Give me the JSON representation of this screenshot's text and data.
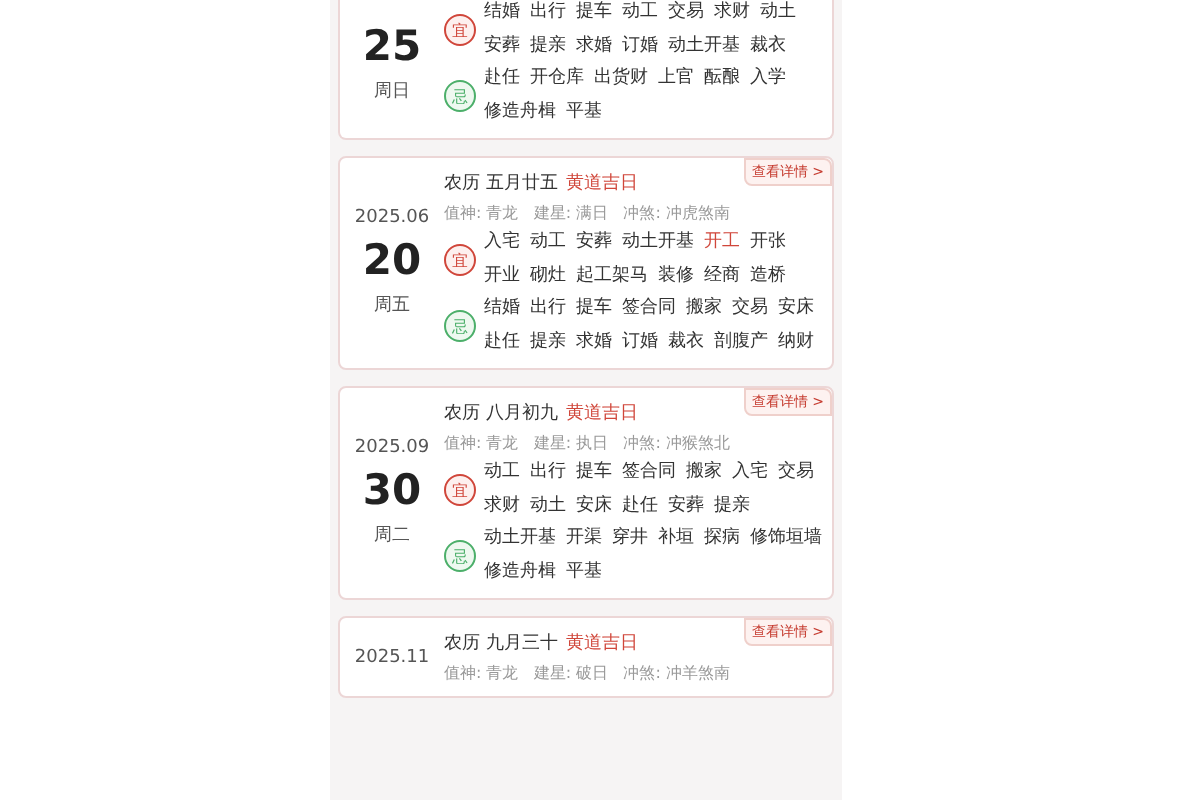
{
  "cards": [
    {
      "cut_top": true,
      "day": "25",
      "weekday": "周日",
      "yi": {
        "label": "宜",
        "items": [
          {
            "text": "结婚",
            "highlighted": false
          },
          {
            "text": "出行",
            "highlighted": false
          },
          {
            "text": "提车",
            "highlighted": false
          },
          {
            "text": "动工",
            "highlighted": false
          },
          {
            "text": "交易",
            "highlighted": false
          },
          {
            "text": "求财",
            "highlighted": false
          },
          {
            "text": "动土",
            "highlighted": false
          },
          {
            "text": "安葬",
            "highlighted": false
          },
          {
            "text": "提亲",
            "highlighted": false
          },
          {
            "text": "求婚",
            "highlighted": false
          },
          {
            "text": "订婚",
            "highlighted": false
          },
          {
            "text": "动土开基",
            "highlighted": false
          },
          {
            "text": "裁衣",
            "highlighted": false
          }
        ]
      },
      "ji": {
        "label": "忌",
        "items": [
          {
            "text": "赴任",
            "highlighted": false
          },
          {
            "text": "开仓库",
            "highlighted": false
          },
          {
            "text": "出货财",
            "highlighted": false
          },
          {
            "text": "上官",
            "highlighted": false
          },
          {
            "text": "酝酿",
            "highlighted": false
          },
          {
            "text": "入学",
            "highlighted": false
          },
          {
            "text": "修造舟楫",
            "highlighted": false
          },
          {
            "text": "平基",
            "highlighted": false
          }
        ]
      }
    },
    {
      "cut_top": false,
      "lunar": "农历 五月廿五",
      "tag": "黄道吉日",
      "link": "查看详情 >",
      "info": "值神: 青龙   建星: 满日   冲煞: 冲虎煞南",
      "month": "2025.06",
      "day": "20",
      "weekday": "周五",
      "yi": {
        "label": "宜",
        "items": [
          {
            "text": "入宅",
            "highlighted": false
          },
          {
            "text": "动工",
            "highlighted": false
          },
          {
            "text": "安葬",
            "highlighted": false
          },
          {
            "text": "动土开基",
            "highlighted": false
          },
          {
            "text": "开工",
            "highlighted": true
          },
          {
            "text": "开张",
            "highlighted": false
          },
          {
            "text": "开业",
            "highlighted": false
          },
          {
            "text": "砌灶",
            "highlighted": false
          },
          {
            "text": "起工架马",
            "highlighted": false
          },
          {
            "text": "装修",
            "highlighted": false
          },
          {
            "text": "经商",
            "highlighted": false
          },
          {
            "text": "造桥",
            "highlighted": false
          }
        ]
      },
      "ji": {
        "label": "忌",
        "items": [
          {
            "text": "结婚",
            "highlighted": false
          },
          {
            "text": "出行",
            "highlighted": false
          },
          {
            "text": "提车",
            "highlighted": false
          },
          {
            "text": "签合同",
            "highlighted": false
          },
          {
            "text": "搬家",
            "highlighted": false
          },
          {
            "text": "交易",
            "highlighted": false
          },
          {
            "text": "安床",
            "highlighted": false
          },
          {
            "text": "赴任",
            "highlighted": false
          },
          {
            "text": "提亲",
            "highlighted": false
          },
          {
            "text": "求婚",
            "highlighted": false
          },
          {
            "text": "订婚",
            "highlighted": false
          },
          {
            "text": "裁衣",
            "highlighted": false
          },
          {
            "text": "剖腹产",
            "highlighted": false
          },
          {
            "text": "纳财",
            "highlighted": false
          }
        ]
      }
    },
    {
      "cut_top": false,
      "lunar": "农历 八月初九",
      "tag": "黄道吉日",
      "link": "查看详情 >",
      "info": "值神: 青龙   建星: 执日   冲煞: 冲猴煞北",
      "month": "2025.09",
      "day": "30",
      "weekday": "周二",
      "yi": {
        "label": "宜",
        "items": [
          {
            "text": "动工",
            "highlighted": false
          },
          {
            "text": "出行",
            "highlighted": false
          },
          {
            "text": "提车",
            "highlighted": false
          },
          {
            "text": "签合同",
            "highlighted": false
          },
          {
            "text": "搬家",
            "highlighted": false
          },
          {
            "text": "入宅",
            "highlighted": false
          },
          {
            "text": "交易",
            "highlighted": false
          },
          {
            "text": "求财",
            "highlighted": false
          },
          {
            "text": "动土",
            "highlighted": false
          },
          {
            "text": "安床",
            "highlighted": false
          },
          {
            "text": "赴任",
            "highlighted": false
          },
          {
            "text": "安葬",
            "highlighted": false
          },
          {
            "text": "提亲",
            "highlighted": false
          }
        ]
      },
      "ji": {
        "label": "忌",
        "items": [
          {
            "text": "动土开基",
            "highlighted": false
          },
          {
            "text": "开渠",
            "highlighted": false
          },
          {
            "text": "穿井",
            "highlighted": false
          },
          {
            "text": "补垣",
            "highlighted": false
          },
          {
            "text": "探病",
            "highlighted": false
          },
          {
            "text": "修饰垣墙",
            "highlighted": false
          },
          {
            "text": "修造舟楫",
            "highlighted": false
          },
          {
            "text": "平基",
            "highlighted": false
          }
        ]
      }
    },
    {
      "cut_top": false,
      "lunar": "农历 九月三十",
      "tag": "黄道吉日",
      "link": "查看详情 >",
      "info": "值神: 青龙   建星: 破日   冲煞: 冲羊煞南",
      "month": "2025.11"
    }
  ]
}
